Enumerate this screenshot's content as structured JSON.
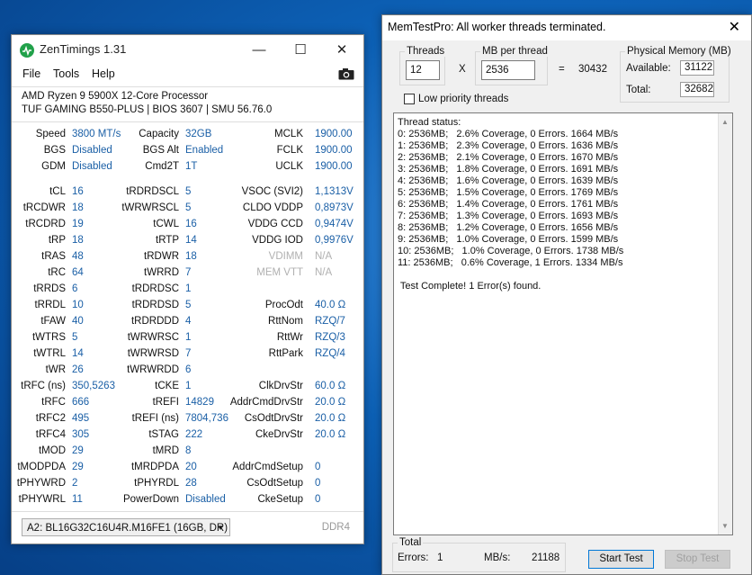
{
  "zentimings": {
    "title": "ZenTimings 1.31",
    "controls": {
      "minimize": "—",
      "maximize": "☐",
      "close": "✕"
    },
    "menu": [
      "File",
      "Tools",
      "Help"
    ],
    "cpu": "AMD Ryzen 9 5900X 12-Core Processor",
    "board": "TUF GAMING B550-PLUS | BIOS 3607 | SMU 56.76.0",
    "rows": [
      [
        "Speed",
        "3800 MT/s",
        "Capacity",
        "32GB",
        "MCLK",
        "1900.00"
      ],
      [
        "BGS",
        "Disabled",
        "BGS Alt",
        "Enabled",
        "FCLK",
        "1900.00"
      ],
      [
        "GDM",
        "Disabled",
        "Cmd2T",
        "1T",
        "UCLK",
        "1900.00"
      ],
      [
        "tCL",
        "16",
        "tRDRDSCL",
        "5",
        "VSOC (SVI2)",
        "1,1313V"
      ],
      [
        "tRCDWR",
        "18",
        "tWRWRSCL",
        "5",
        "CLDO VDDP",
        "0,8973V"
      ],
      [
        "tRCDRD",
        "19",
        "tCWL",
        "16",
        "VDDG CCD",
        "0,9474V"
      ],
      [
        "tRP",
        "18",
        "tRTP",
        "14",
        "VDDG IOD",
        "0,9976V"
      ],
      [
        "tRAS",
        "48",
        "tRDWR",
        "18",
        "VDIMM",
        "N/A"
      ],
      [
        "tRC",
        "64",
        "tWRRD",
        "7",
        "MEM VTT",
        "N/A"
      ],
      [
        "tRRDS",
        "6",
        "tRDRDSC",
        "1",
        "",
        ""
      ],
      [
        "tRRDL",
        "10",
        "tRDRDSD",
        "5",
        "ProcOdt",
        "40.0 Ω"
      ],
      [
        "tFAW",
        "40",
        "tRDRDDD",
        "4",
        "RttNom",
        "RZQ/7"
      ],
      [
        "tWTRS",
        "5",
        "tWRWRSC",
        "1",
        "RttWr",
        "RZQ/3"
      ],
      [
        "tWTRL",
        "14",
        "tWRWRSD",
        "7",
        "RttPark",
        "RZQ/4"
      ],
      [
        "tWR",
        "26",
        "tWRWRDD",
        "6",
        "",
        ""
      ],
      [
        "tRFC (ns)",
        "350,5263",
        "tCKE",
        "1",
        "ClkDrvStr",
        "60.0 Ω"
      ],
      [
        "tRFC",
        "666",
        "tREFI",
        "14829",
        "AddrCmdDrvStr",
        "20.0 Ω"
      ],
      [
        "tRFC2",
        "495",
        "tREFI (ns)",
        "7804,736",
        "CsOdtDrvStr",
        "20.0 Ω"
      ],
      [
        "tRFC4",
        "305",
        "tSTAG",
        "222",
        "CkeDrvStr",
        "20.0 Ω"
      ],
      [
        "tMOD",
        "29",
        "tMRD",
        "8",
        "",
        ""
      ],
      [
        "tMODPDA",
        "29",
        "tMRDPDA",
        "20",
        "AddrCmdSetup",
        "0"
      ],
      [
        "tPHYWRD",
        "2",
        "tPHYRDL",
        "28",
        "CsOdtSetup",
        "0"
      ],
      [
        "tPHYWRL",
        "11",
        "PowerDown",
        "Disabled",
        "CkeSetup",
        "0"
      ]
    ],
    "module_select": "A2: BL16G32C16U4R.M16FE1 (16GB, DR)",
    "ddr": "DDR4"
  },
  "memtest": {
    "title": "MemTestPro: All worker threads terminated.",
    "close": "✕",
    "threads_label": "Threads",
    "threads_value": "12",
    "times": "X",
    "mb_label": "MB per thread",
    "mb_value": "2536",
    "equals": "=",
    "total_mb": "30432",
    "phys_label": "Physical Memory (MB)",
    "available_label": "Available:",
    "available_value": "31122",
    "total_label": "Total:",
    "total_value": "32682",
    "low_priority": "Low priority threads",
    "status_lines": [
      "Thread status:",
      "0: 2536MB;   2.6% Coverage, 0 Errors. 1664 MB/s",
      "1: 2536MB;   2.3% Coverage, 0 Errors. 1636 MB/s",
      "2: 2536MB;   2.1% Coverage, 0 Errors. 1670 MB/s",
      "3: 2536MB;   1.8% Coverage, 0 Errors. 1691 MB/s",
      "4: 2536MB;   1.6% Coverage, 0 Errors. 1639 MB/s",
      "5: 2536MB;   1.5% Coverage, 0 Errors. 1769 MB/s",
      "6: 2536MB;   1.4% Coverage, 0 Errors. 1761 MB/s",
      "7: 2536MB;   1.3% Coverage, 0 Errors. 1693 MB/s",
      "8: 2536MB;   1.2% Coverage, 0 Errors. 1656 MB/s",
      "9: 2536MB;   1.0% Coverage, 0 Errors. 1599 MB/s",
      "10: 2536MB;   1.0% Coverage, 0 Errors. 1738 MB/s",
      "11: 2536MB;   0.6% Coverage, 1 Errors. 1334 MB/s",
      "",
      " Test Complete! 1 Error(s) found."
    ],
    "total_group": "Total",
    "errors_label": "Errors:",
    "errors_value": "1",
    "mbs_label": "MB/s:",
    "mbs_value": "21188",
    "start_button": "Start Test",
    "stop_button": "Stop Test"
  }
}
